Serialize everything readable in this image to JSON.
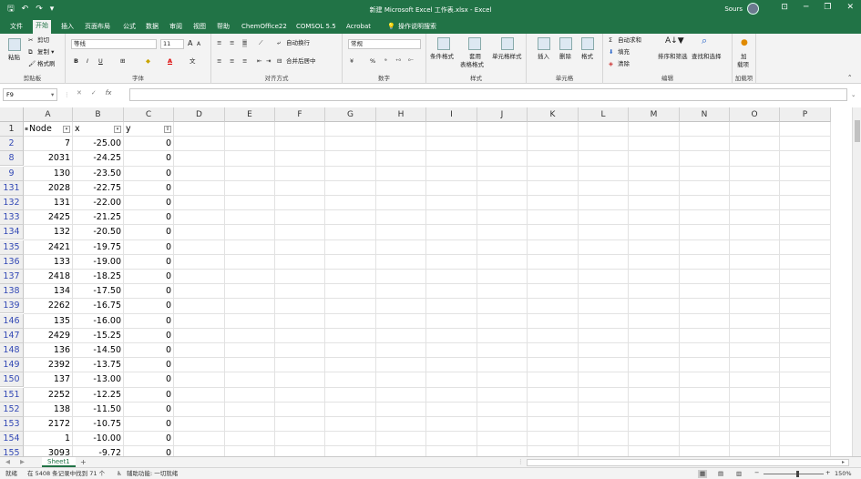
{
  "app": {
    "title": "新建 Microsoft Excel 工作表.xlsx  -  Excel",
    "user": "Sours",
    "qat": {
      "save": "🖫",
      "undo": "↶",
      "redo": "↷",
      "more": "▾"
    },
    "window": {
      "minimize": "─",
      "restore": "❐",
      "close": "✕",
      "ribbon_options": "⊡"
    }
  },
  "tabs": [
    "文件",
    "开始",
    "插入",
    "页面布局",
    "公式",
    "数据",
    "审阅",
    "视图",
    "帮助",
    "ChemOffice22",
    "COMSOL 5.5",
    "Acrobat",
    "操作说明搜索"
  ],
  "active_tab": 1,
  "ribbon": {
    "clipboard": {
      "paste": "粘贴",
      "cut": "剪切",
      "copy": "复制 ▾",
      "format_painter": "格式刷",
      "label": "剪贴板"
    },
    "font": {
      "name": "等线",
      "size": "11",
      "grow": "A",
      "shrink": "A",
      "bold": "B",
      "italic": "I",
      "underline": "U",
      "border": "⊞",
      "fill": "◆",
      "color": "A",
      "phonetic": "文",
      "label": "字体"
    },
    "alignment": {
      "wrap": "自动换行",
      "merge": "合并后居中",
      "label": "对齐方式"
    },
    "number": {
      "format": "常规",
      "currency": "¥",
      "percent": "%",
      "comma": "⁹",
      "label": "数字"
    },
    "styles": {
      "conditional": "条件格式",
      "table1": "套用",
      "table2": "表格格式",
      "cell_styles": "单元格样式",
      "label": "样式"
    },
    "cells": {
      "insert": "插入",
      "delete": "删除",
      "format": "格式",
      "label": "单元格"
    },
    "editing": {
      "autosum": "自动求和",
      "fill": "填充",
      "clear": "清除",
      "sort": "排序和筛选",
      "find": "查找和选择",
      "label": "编辑"
    },
    "addins": {
      "load1": "加",
      "load2": "载项",
      "label": "加载项"
    }
  },
  "formula_bar": {
    "name_box": "F9",
    "cancel": "✕",
    "enter": "✓",
    "fx": "fx",
    "value": ""
  },
  "columns": [
    "A",
    "B",
    "C",
    "D",
    "E",
    "F",
    "G",
    "H",
    "I",
    "J",
    "K",
    "L",
    "M",
    "N",
    "O",
    "P"
  ],
  "headers_row": {
    "row_num": "1",
    "a": "Node",
    "b": "x",
    "c": "y"
  },
  "rows": [
    {
      "n": "2",
      "a": "7",
      "b": "-25.00",
      "c": "0"
    },
    {
      "n": "8",
      "a": "2031",
      "b": "-24.25",
      "c": "0"
    },
    {
      "n": "9",
      "a": "130",
      "b": "-23.50",
      "c": "0"
    },
    {
      "n": "131",
      "a": "2028",
      "b": "-22.75",
      "c": "0"
    },
    {
      "n": "132",
      "a": "131",
      "b": "-22.00",
      "c": "0"
    },
    {
      "n": "133",
      "a": "2425",
      "b": "-21.25",
      "c": "0"
    },
    {
      "n": "134",
      "a": "132",
      "b": "-20.50",
      "c": "0"
    },
    {
      "n": "135",
      "a": "2421",
      "b": "-19.75",
      "c": "0"
    },
    {
      "n": "136",
      "a": "133",
      "b": "-19.00",
      "c": "0"
    },
    {
      "n": "137",
      "a": "2418",
      "b": "-18.25",
      "c": "0"
    },
    {
      "n": "138",
      "a": "134",
      "b": "-17.50",
      "c": "0"
    },
    {
      "n": "139",
      "a": "2262",
      "b": "-16.75",
      "c": "0"
    },
    {
      "n": "146",
      "a": "135",
      "b": "-16.00",
      "c": "0"
    },
    {
      "n": "147",
      "a": "2429",
      "b": "-15.25",
      "c": "0"
    },
    {
      "n": "148",
      "a": "136",
      "b": "-14.50",
      "c": "0"
    },
    {
      "n": "149",
      "a": "2392",
      "b": "-13.75",
      "c": "0"
    },
    {
      "n": "150",
      "a": "137",
      "b": "-13.00",
      "c": "0"
    },
    {
      "n": "151",
      "a": "2252",
      "b": "-12.25",
      "c": "0"
    },
    {
      "n": "152",
      "a": "138",
      "b": "-11.50",
      "c": "0"
    },
    {
      "n": "153",
      "a": "2172",
      "b": "-10.75",
      "c": "0"
    },
    {
      "n": "154",
      "a": "1",
      "b": "-10.00",
      "c": "0"
    },
    {
      "n": "155",
      "a": "3093",
      "b": "-9.72",
      "c": "0"
    }
  ],
  "sheet_tabs": [
    "Sheet1"
  ],
  "add_sheet": "+",
  "status": {
    "mode": "就绪",
    "filter_info": "在 5408 条记录中找到 71 个",
    "accessibility": "辅助功能: 一切就绪",
    "zoom": "150%",
    "zoom_minus": "−",
    "zoom_plus": "+"
  }
}
